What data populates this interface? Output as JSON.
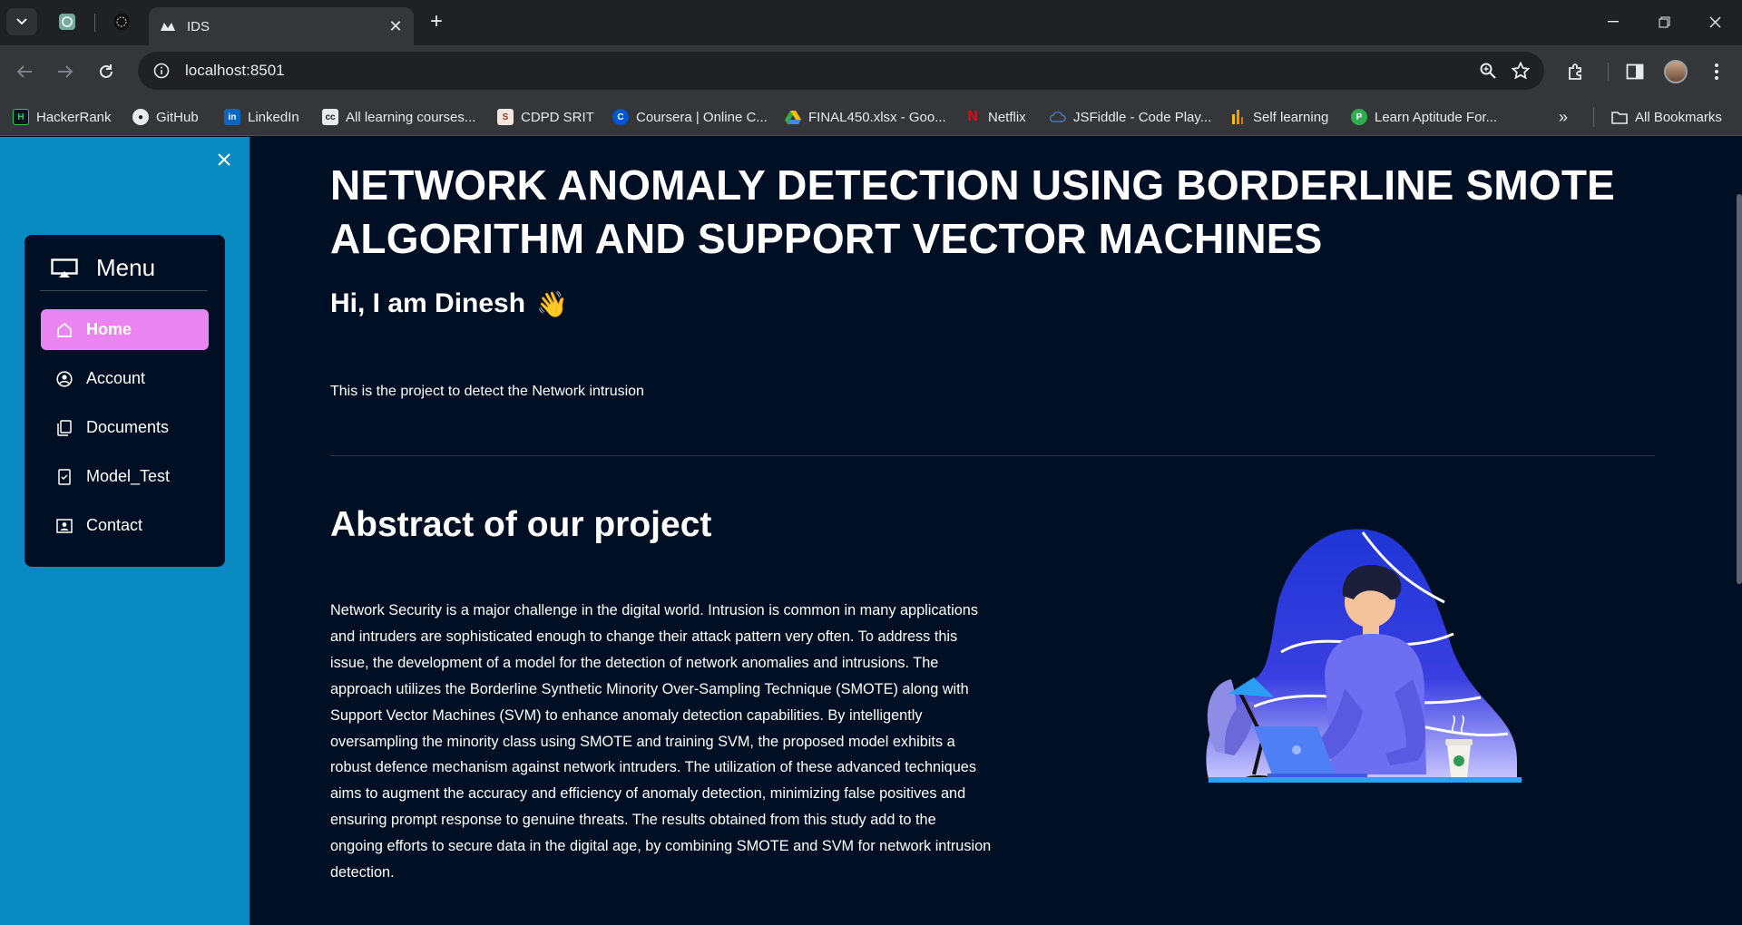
{
  "browser": {
    "tab_title": "IDS",
    "url": "localhost:8501",
    "bookmarks": [
      {
        "label": "HackerRank",
        "icon": "hackerrank-icon"
      },
      {
        "label": "GitHub",
        "icon": "github-icon"
      },
      {
        "label": "LinkedIn",
        "icon": "linkedin-icon"
      },
      {
        "label": "All learning courses...",
        "icon": "cc-icon"
      },
      {
        "label": "CDPD SRIT",
        "icon": "cdpd-icon"
      },
      {
        "label": "Coursera | Online C...",
        "icon": "coursera-icon"
      },
      {
        "label": "FINAL450.xlsx - Goo...",
        "icon": "google-drive-icon"
      },
      {
        "label": "Netflix",
        "icon": "netflix-icon"
      },
      {
        "label": "JSFiddle - Code Play...",
        "icon": "jsfiddle-icon"
      },
      {
        "label": "Self learning",
        "icon": "self-learning-icon"
      },
      {
        "label": "Learn Aptitude For...",
        "icon": "aptitude-icon"
      }
    ],
    "all_bookmarks": "All Bookmarks"
  },
  "sidebar": {
    "menu_title": "Menu",
    "accent": "#e984f0",
    "background": "#0a8ac2",
    "items": [
      {
        "label": "Home",
        "icon": "home-icon",
        "active": true
      },
      {
        "label": "Account",
        "icon": "account-icon",
        "active": false
      },
      {
        "label": "Documents",
        "icon": "documents-icon",
        "active": false
      },
      {
        "label": "Model_Test",
        "icon": "checklist-icon",
        "active": false
      },
      {
        "label": "Contact",
        "icon": "contact-icon",
        "active": false
      }
    ]
  },
  "main": {
    "title": "NETWORK ANOMALY DETECTION USING BORDERLINE SMOTE ALGORITHM AND SUPPORT VECTOR MACHINES",
    "greeting": "Hi, I am Dinesh",
    "greeting_emoji": "👋",
    "lead": "This is the project to detect the Network intrusion",
    "abstract_heading": "Abstract of our project",
    "abstract_text": "Network Security is a major challenge in the digital world. Intrusion is common in many applications and intruders are sophisticated enough to change their attack pattern very often. To address this issue, the development of a model for the detection of network anomalies and intrusions. The approach utilizes the Borderline Synthetic Minority Over-Sampling Technique (SMOTE) along with Support Vector Machines (SVM) to enhance anomaly detection capabilities. By intelligently oversampling the minority class using SMOTE and training SVM, the proposed model exhibits a robust defence mechanism against network intruders. The utilization of these advanced techniques aims to augment the accuracy and efficiency of anomaly detection, minimizing false positives and ensuring prompt response to genuine threats. The results obtained from this study add to the ongoing efforts to secure data in the digital age, by combining SMOTE and SVM for network intrusion detection."
  }
}
